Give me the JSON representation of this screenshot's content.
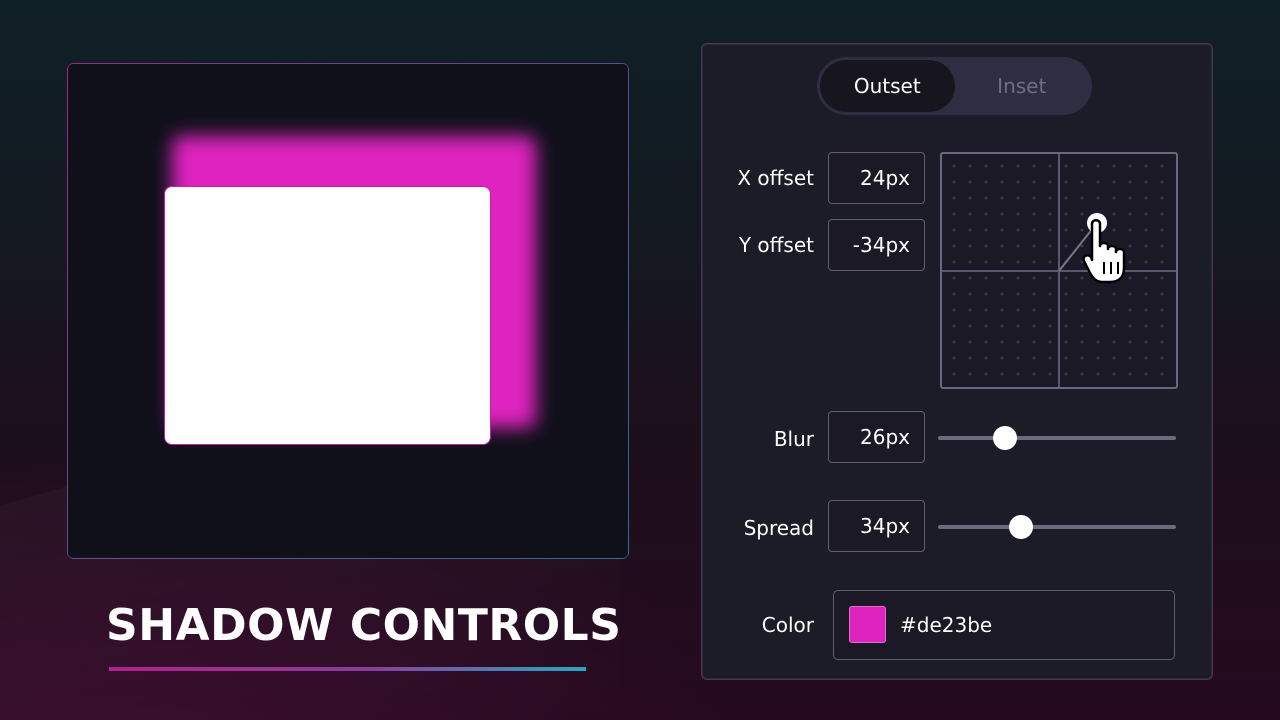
{
  "title": "SHADOW CONTROLS",
  "mode_toggle": {
    "options": [
      "Outset",
      "Inset"
    ],
    "selected": "Outset"
  },
  "controls": {
    "x_offset": {
      "label": "X offset",
      "value": "24px"
    },
    "y_offset": {
      "label": "Y offset",
      "value": "-34px"
    },
    "blur": {
      "label": "Blur",
      "value": "26px",
      "level": 0.28
    },
    "spread": {
      "label": "Spread",
      "value": "34px",
      "level": 0.35
    },
    "color": {
      "label": "Color",
      "value": "#de23be"
    }
  },
  "colors": {
    "shadow": "#de23be",
    "card": "#ffffff",
    "panel_bg": "#1c1b28",
    "preview_bg": "#10101b"
  },
  "icons": {
    "pointer": "hand-pointer-icon"
  }
}
